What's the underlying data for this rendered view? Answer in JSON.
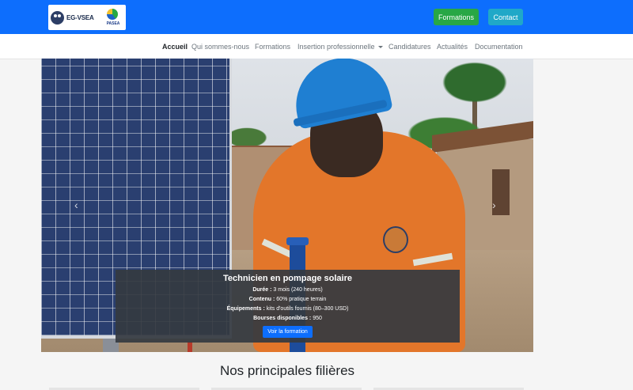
{
  "header": {
    "logo_text": "EG-VSEA",
    "logo_secondary": "PASEA",
    "formations_btn": "Formations",
    "contact_btn": "Contact"
  },
  "nav": {
    "items": [
      "Accueil",
      "Qui sommes-nous",
      "Formations",
      "Insertion professionnelle",
      "Candidatures",
      "Actualités",
      "Documentation"
    ]
  },
  "carousel": {
    "prev_glyph": "‹",
    "next_glyph": "›",
    "caption": {
      "title": "Technicien en pompage solaire",
      "lines": [
        {
          "label": "Durée :",
          "value": " 3 mois (240 heures)"
        },
        {
          "label": "Contenu :",
          "value": " 60% pratique terrain"
        },
        {
          "label": "Équipements :",
          "value": " kits d'outils fournis (80–300 USD)"
        },
        {
          "label": "Bourses disponibles :",
          "value": " 950"
        }
      ],
      "button": "Voir la formation"
    }
  },
  "section": {
    "title": "Nos principales filières"
  },
  "colors": {
    "primary": "#0d6efd",
    "success": "#28a745",
    "info": "#20a8c8",
    "caption_bg": "#343a40"
  }
}
